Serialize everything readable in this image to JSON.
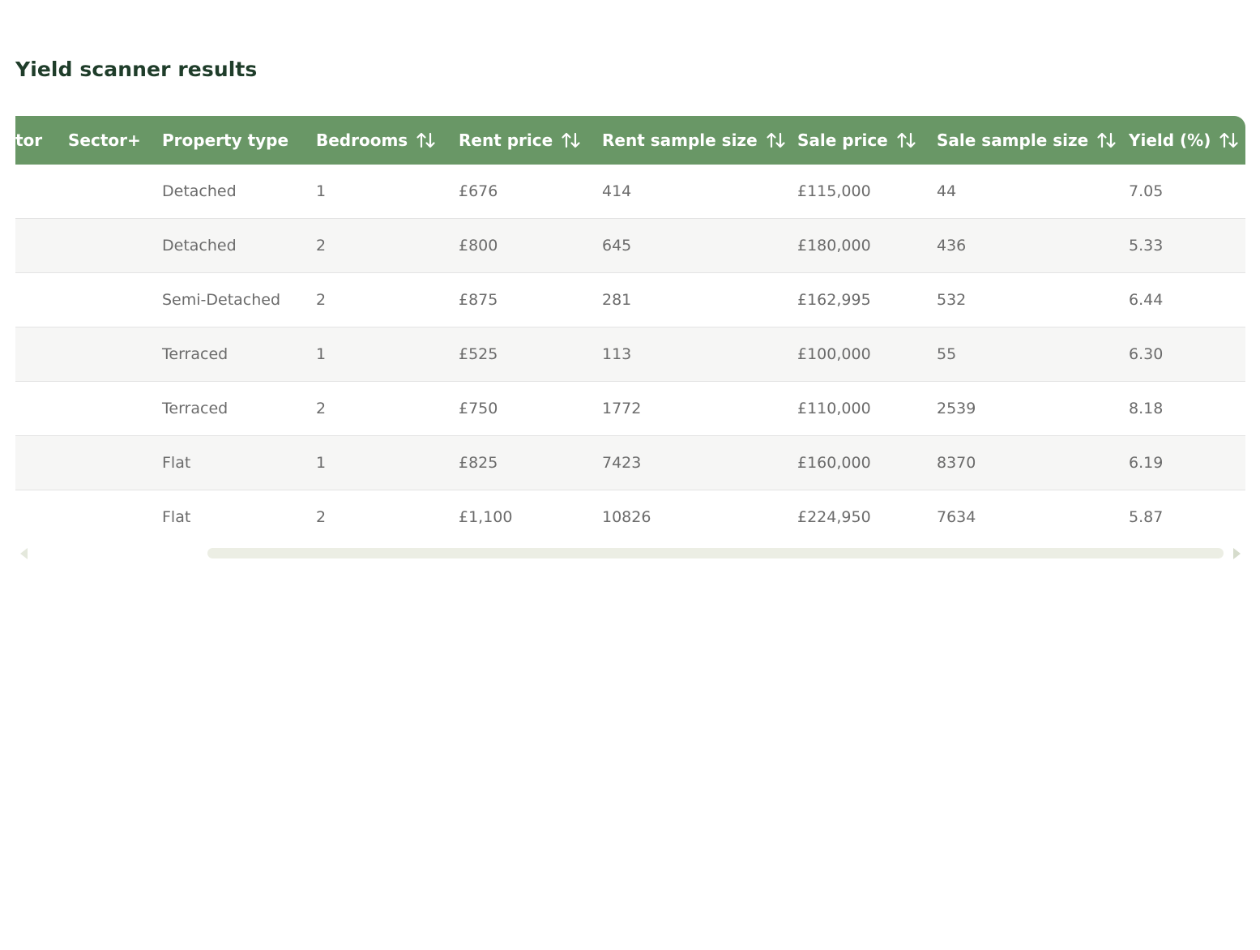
{
  "page": {
    "title": "Yield scanner results"
  },
  "colors": {
    "header_bg": "#699766",
    "header_text": "#ffffff",
    "title_text": "#1f3d2a",
    "row_alt_bg": "#f6f6f5",
    "cell_text": "#6b6b6b"
  },
  "table": {
    "columns": {
      "sector_cut": "tor",
      "sector_plus": "Sector+",
      "property_type": "Property type",
      "bedrooms": "Bedrooms",
      "rent_price": "Rent price",
      "rent_sample_size": "Rent sample size",
      "sale_price": "Sale price",
      "sale_sample_size": "Sale sample size",
      "yield": "Yield (%)"
    },
    "sort_icon": "sort-up-down-icon",
    "rows": [
      {
        "sector": "",
        "sector_plus": "",
        "property_type": "Detached",
        "bedrooms": "1",
        "rent_price": "£676",
        "rent_sample_size": "414",
        "sale_price": "£115,000",
        "sale_sample_size": "44",
        "yield": "7.05"
      },
      {
        "sector": "",
        "sector_plus": "",
        "property_type": "Detached",
        "bedrooms": "2",
        "rent_price": "£800",
        "rent_sample_size": "645",
        "sale_price": "£180,000",
        "sale_sample_size": "436",
        "yield": "5.33"
      },
      {
        "sector": "",
        "sector_plus": "",
        "property_type": "Semi-Detached",
        "bedrooms": "2",
        "rent_price": "£875",
        "rent_sample_size": "281",
        "sale_price": "£162,995",
        "sale_sample_size": "532",
        "yield": "6.44"
      },
      {
        "sector": "",
        "sector_plus": "",
        "property_type": "Terraced",
        "bedrooms": "1",
        "rent_price": "£525",
        "rent_sample_size": "113",
        "sale_price": "£100,000",
        "sale_sample_size": "55",
        "yield": "6.30"
      },
      {
        "sector": "",
        "sector_plus": "",
        "property_type": "Terraced",
        "bedrooms": "2",
        "rent_price": "£750",
        "rent_sample_size": "1772",
        "sale_price": "£110,000",
        "sale_sample_size": "2539",
        "yield": "8.18"
      },
      {
        "sector": "",
        "sector_plus": "",
        "property_type": "Flat",
        "bedrooms": "1",
        "rent_price": "£825",
        "rent_sample_size": "7423",
        "sale_price": "£160,000",
        "sale_sample_size": "8370",
        "yield": "6.19"
      },
      {
        "sector": "",
        "sector_plus": "",
        "property_type": "Flat",
        "bedrooms": "2",
        "rent_price": "£1,100",
        "rent_sample_size": "10826",
        "sale_price": "£224,950",
        "sale_sample_size": "7634",
        "yield": "5.87"
      }
    ]
  }
}
